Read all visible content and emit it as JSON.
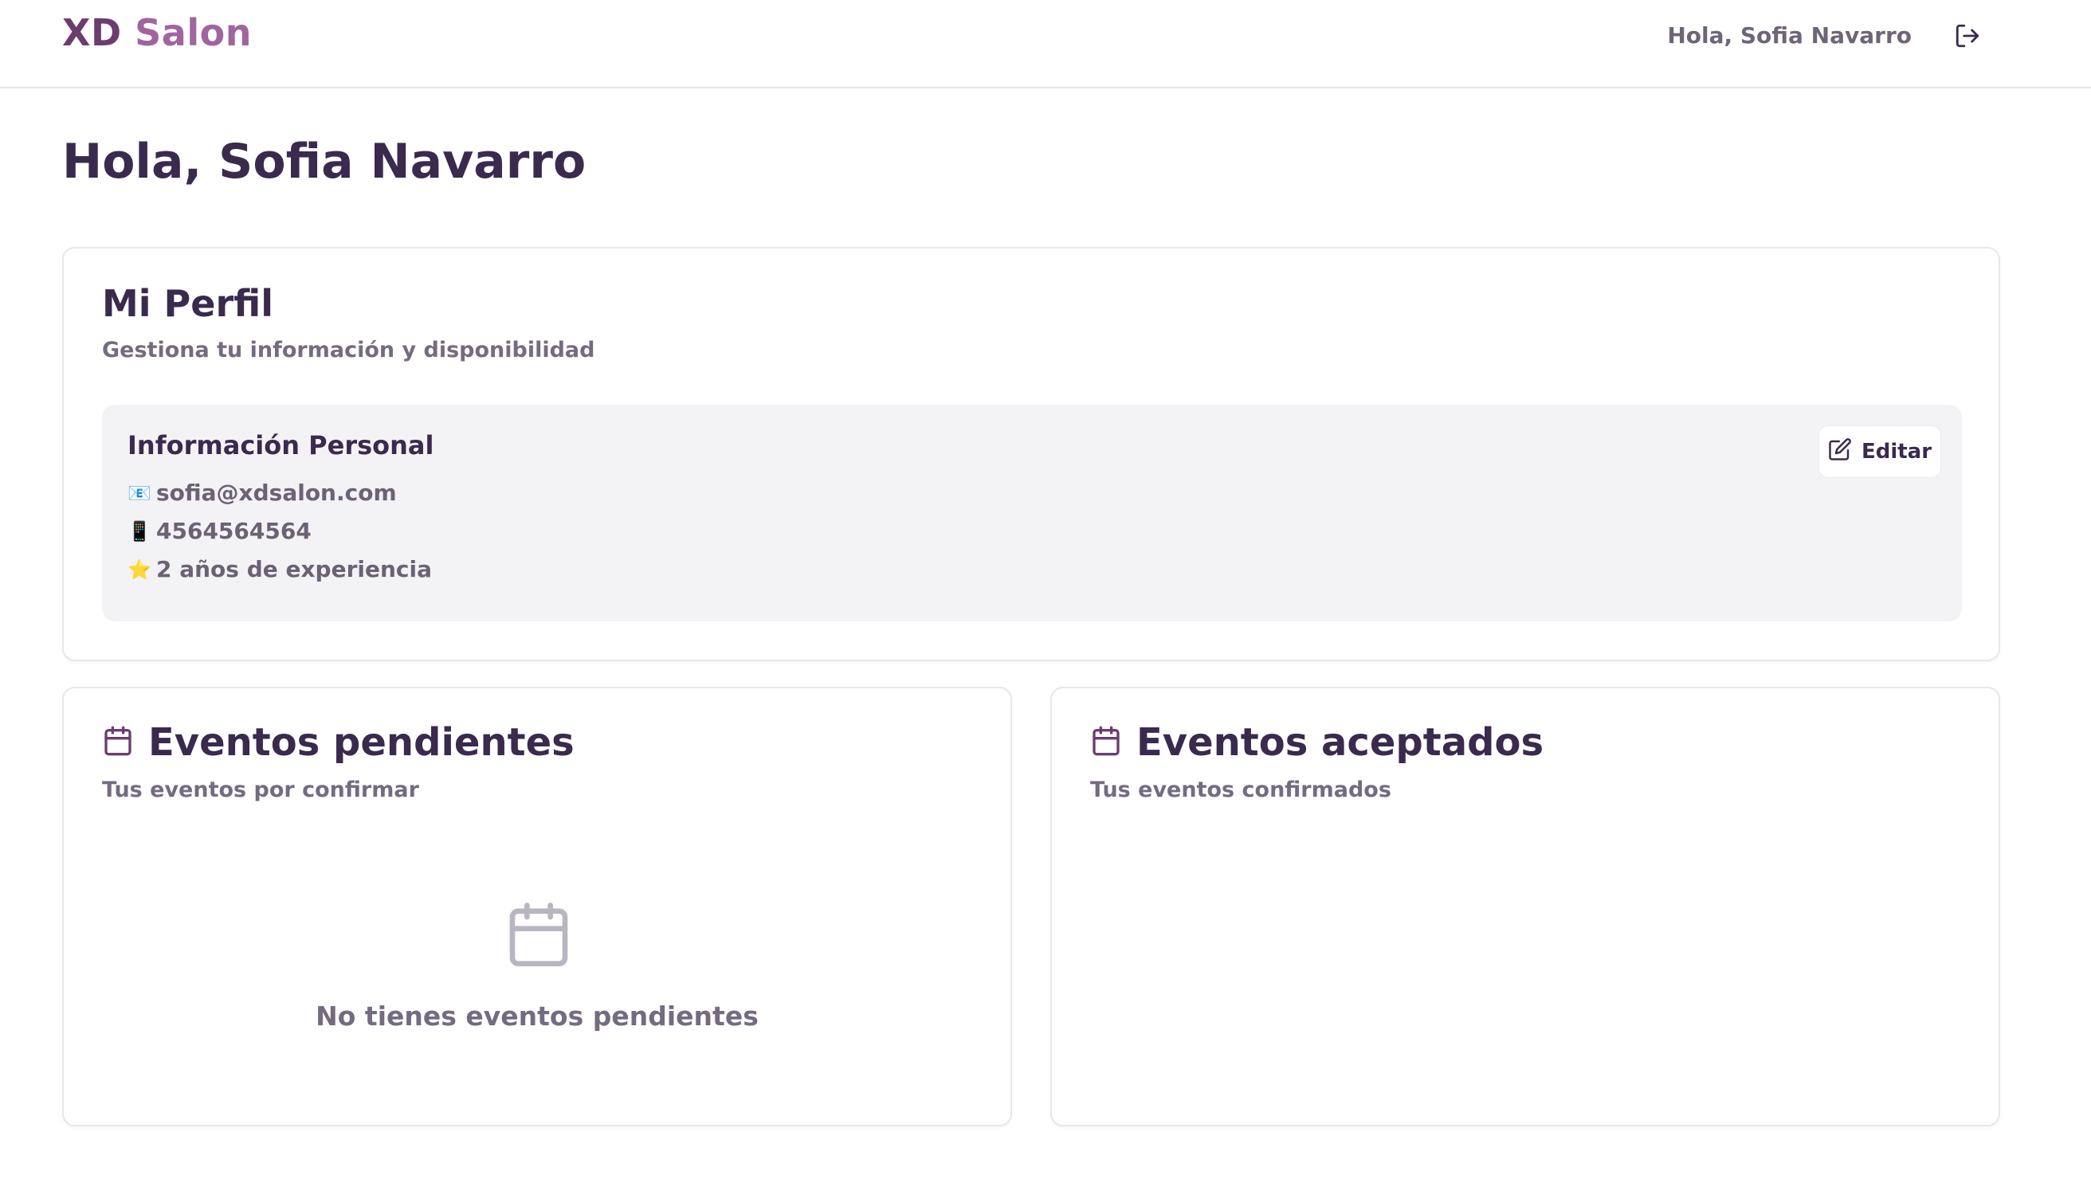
{
  "header": {
    "brand_part1": "XD",
    "brand_part2": " Salon",
    "greeting": "Hola, Sofia Navarro",
    "logout_icon": "logout-icon"
  },
  "page": {
    "title": "Hola, Sofia Navarro"
  },
  "profile": {
    "title": "Mi Perfil",
    "subtitle": "Gestiona tu información y disponibilidad",
    "info_title": "Información Personal",
    "email_icon": "📧",
    "email": "sofia@xdsalon.com",
    "phone_icon": "📱",
    "phone": "4564564564",
    "experience_icon": "⭐",
    "experience": "2 años de experiencia",
    "edit_label": "Editar"
  },
  "pending": {
    "title": "Eventos pendientes",
    "subtitle": "Tus eventos por confirmar",
    "empty_text": "No tienes eventos pendientes"
  },
  "accepted": {
    "title": "Eventos aceptados",
    "subtitle": "Tus eventos confirmados"
  },
  "colors": {
    "brand_dark": "#6b3d6e",
    "brand_light": "#a0659f",
    "heading": "#3a2a4d",
    "muted": "#756b80",
    "panel_bg": "#f3f2f5"
  }
}
